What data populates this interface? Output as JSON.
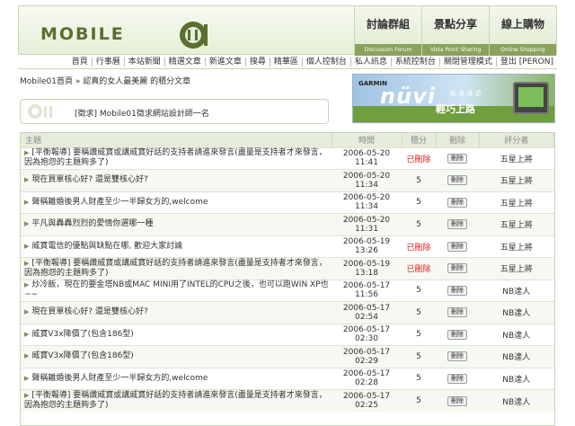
{
  "logo": {
    "text": "MOBILE"
  },
  "tabs": [
    {
      "label": "討論群組",
      "sub": "Discussion Forum"
    },
    {
      "label": "景點分享",
      "sub": "Vista Point Sharing"
    },
    {
      "label": "線上購物",
      "sub": "Online Shopping"
    }
  ],
  "nav": [
    "首頁",
    "行事曆",
    "本站新聞",
    "精選文章",
    "新進文章",
    "搜尋",
    "精華區",
    "個人控制台",
    "私人訊息",
    "系統控制台",
    "關閉管理模式",
    "登出 [PERON]"
  ],
  "breadcrumb": "Mobile01首頁 » 認真的女人最美麗 的積分文章",
  "banner": {
    "brand": "GARMIN",
    "product": "nüvi",
    "tagline": "點 身 導 遊",
    "slogan": "輕巧上路"
  },
  "announcement": "[徵求] Mobile01徵求網站設計師一名",
  "table": {
    "headers": {
      "subject": "主題",
      "time": "時間",
      "points": "積分",
      "delete": "刪除",
      "rater": "評分者"
    },
    "rows": [
      {
        "subject": "[平衡報導] 要稱讚威寶或講威寶好話的支持者請進來發言(盡量是支持者才來發言，因為抱怨的主題夠多了)",
        "time": "2006-05-20 11:41",
        "points": "已刪除",
        "deleted": true,
        "delete": "刪除",
        "rater": "五星上將"
      },
      {
        "subject": "現在買單核心好? 還是雙核心好?",
        "time": "2006-05-20 11:34",
        "points": "5",
        "deleted": false,
        "delete": "刪除",
        "rater": "五星上將"
      },
      {
        "subject": "聲稱離婚後男人財產至少一半歸女方的,welcome",
        "time": "2006-05-20 11:34",
        "points": "5",
        "deleted": false,
        "delete": "刪除",
        "rater": "五星上將"
      },
      {
        "subject": "平凡與轟轟烈烈的愛情你選哪一種",
        "time": "2006-05-20 11:31",
        "points": "5",
        "deleted": false,
        "delete": "刪除",
        "rater": "五星上將"
      },
      {
        "subject": "威寶電信的優點與缺點在哪, 歡迎大家討論",
        "time": "2006-05-19 13:26",
        "points": "已刪除",
        "deleted": true,
        "delete": "刪除",
        "rater": "五星上將"
      },
      {
        "subject": "[平衡報導] 要稱讚威寶或講威寶好話的支持者請進來發言(盡量是支持者才來發言，因為抱怨的主題夠多了)",
        "time": "2006-05-19 13:18",
        "points": "已刪除",
        "deleted": true,
        "delete": "刪除",
        "rater": "五星上將"
      },
      {
        "subject": "炒冷飯，現在的要金塔NB或MAC MINI用了INTEL的CPU之後，也可以跑WIN XP也~~",
        "time": "2006-05-17 11:56",
        "points": "5",
        "deleted": false,
        "delete": "刪除",
        "rater": "NB達人"
      },
      {
        "subject": "現在買單核心好? 還是雙核心好?",
        "time": "2006-05-17 02:54",
        "points": "5",
        "deleted": false,
        "delete": "刪除",
        "rater": "NB達人"
      },
      {
        "subject": "威寶V3x降價了(包含186型)",
        "time": "2006-05-17 02:30",
        "points": "5",
        "deleted": false,
        "delete": "刪除",
        "rater": "NB達人"
      },
      {
        "subject": "威寶V3x降價了(包含186型)",
        "time": "2006-05-17 02:29",
        "points": "5",
        "deleted": false,
        "delete": "刪除",
        "rater": "NB達人"
      },
      {
        "subject": "聲稱離婚後男人財產至少一半歸女方的,welcome",
        "time": "2006-05-17 02:28",
        "points": "5",
        "deleted": false,
        "delete": "刪除",
        "rater": "NB達人"
      },
      {
        "subject": "[平衡報導] 要稱讚威寶或講威寶好話的支持者請進來發言(盡量是支持者才來發言，因為抱怨的主題夠多了)",
        "time": "2006-05-17 02:25",
        "points": "5",
        "deleted": false,
        "delete": "刪除",
        "rater": "NB達人"
      }
    ]
  },
  "colors": {
    "accent": "#8aa25a",
    "deleted": "#e02020",
    "header_bg": "#e6ecdc"
  }
}
